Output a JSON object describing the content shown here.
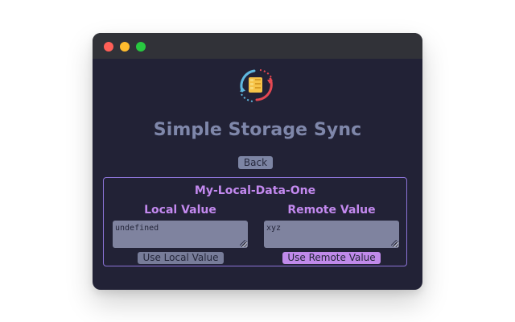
{
  "window": {
    "controls": [
      "close",
      "minimize",
      "zoom"
    ]
  },
  "app": {
    "title": "Simple Storage Sync",
    "logo_icon": "storage-sync-icon"
  },
  "navigation": {
    "back_label": "Back"
  },
  "storage_item": {
    "key": "My-Local-Data-One",
    "local": {
      "heading": "Local Value",
      "value": "undefined",
      "button_label": "Use Local Value"
    },
    "remote": {
      "heading": "Remote Value",
      "value": "xyz",
      "button_label": "Use Remote Value"
    }
  },
  "colors": {
    "window_background": "#222236",
    "titlebar": "#313238",
    "title_text": "#7f87aa",
    "accent_purple": "#c389ef",
    "remote_button": "#c08aea",
    "input_background": "#7f839f"
  }
}
